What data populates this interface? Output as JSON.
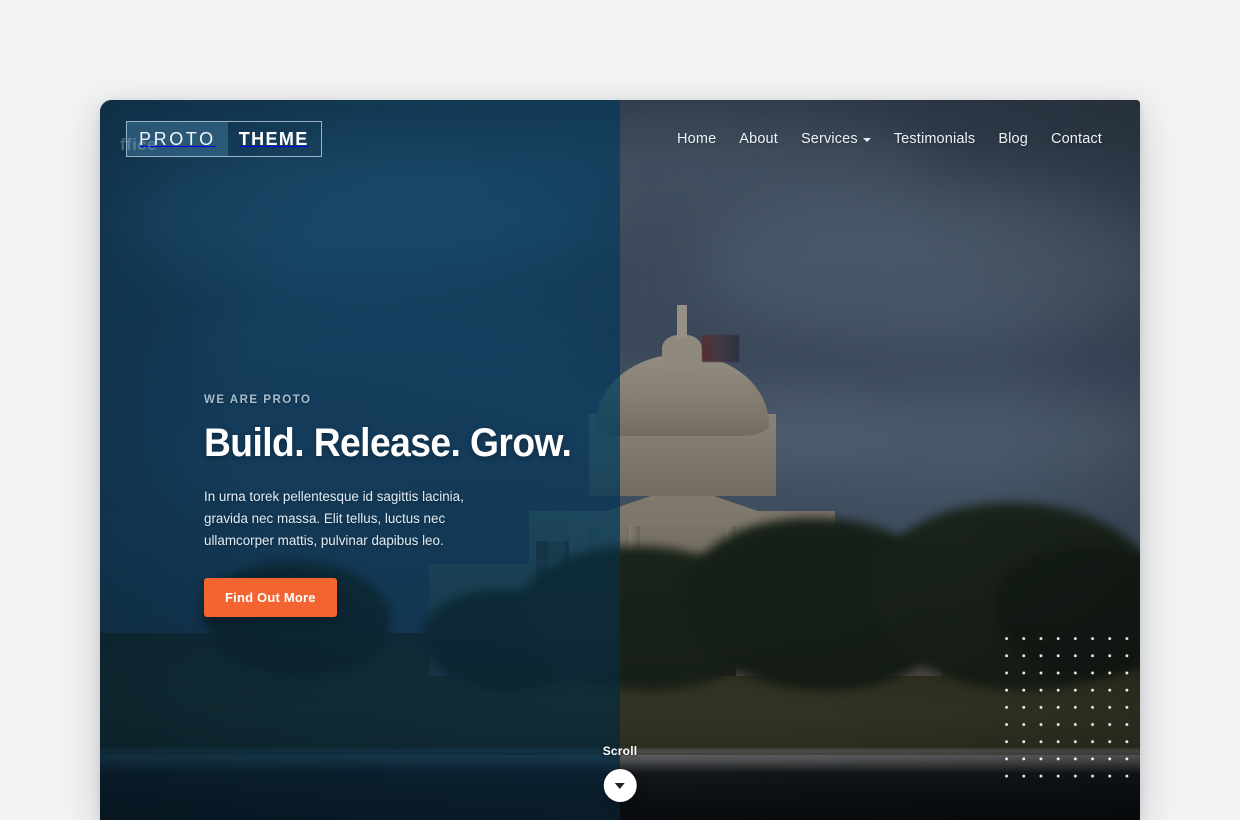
{
  "site": {
    "background_color": "#f2f2f2",
    "ghost_text": "ffice"
  },
  "header": {
    "logo": {
      "part_one": "PROTO",
      "part_two": "THEME"
    },
    "nav": [
      {
        "label": "Home",
        "has_dropdown": false
      },
      {
        "label": "About",
        "has_dropdown": false
      },
      {
        "label": "Services",
        "has_dropdown": true
      },
      {
        "label": "Testimonials",
        "has_dropdown": false
      },
      {
        "label": "Blog",
        "has_dropdown": false
      },
      {
        "label": "Contact",
        "has_dropdown": false
      }
    ]
  },
  "hero": {
    "eyebrow": "WE ARE PROTO",
    "headline": "Build. Release. Grow.",
    "subcopy": "In urna torek pellentesque id sagittis lacinia, gravida nec massa. Elit tellus, luctus nec ullamcorper mattis, pulvinar dapibus leo.",
    "cta_label": "Find Out More",
    "cta_color": "#f26531",
    "tint_left_color": "#10516f",
    "tint_right_color": "#131a22"
  },
  "scroll": {
    "label": "Scroll",
    "icon": "chevron-down-icon"
  },
  "decoration": {
    "dot_grid": {
      "columns": 9,
      "rows": 9,
      "dot_color": "#ffffff"
    }
  }
}
